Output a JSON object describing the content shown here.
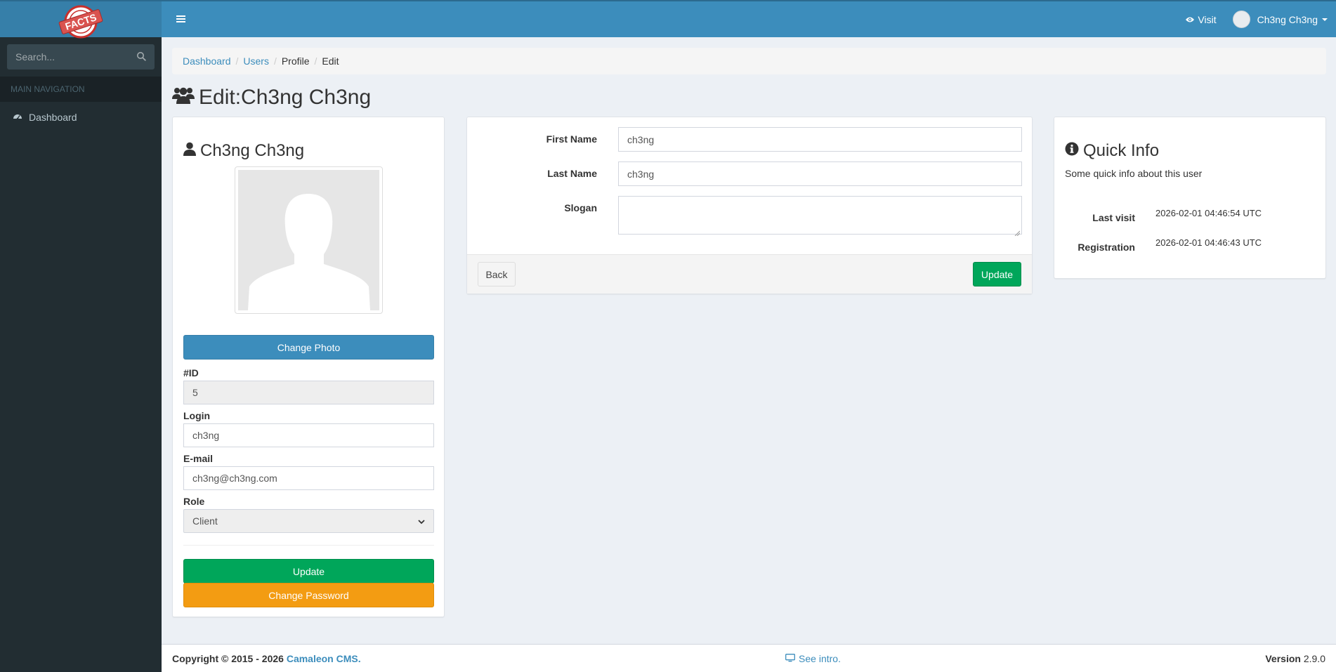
{
  "sidebar": {
    "logo_text": "FACTS",
    "search_placeholder": "Search...",
    "nav_header": "MAIN NAVIGATION",
    "items": [
      {
        "label": "Dashboard",
        "icon": "dashboard-icon"
      }
    ]
  },
  "topbar": {
    "visit_label": "Visit",
    "user_name": "Ch3ng Ch3ng"
  },
  "breadcrumb": {
    "items": [
      "Dashboard",
      "Users",
      "Profile",
      "Edit"
    ]
  },
  "page": {
    "title": "Edit:Ch3ng Ch3ng"
  },
  "profile": {
    "name": "Ch3ng Ch3ng",
    "change_photo_label": "Change Photo",
    "id_label": "#ID",
    "id_value": "5",
    "login_label": "Login",
    "login_value": "ch3ng",
    "email_label": "E-mail",
    "email_value": "ch3ng@ch3ng.com",
    "role_label": "Role",
    "role_value": "Client",
    "update_label": "Update",
    "change_password_label": "Change Password"
  },
  "form": {
    "first_name_label": "First Name",
    "first_name_value": "ch3ng",
    "last_name_label": "Last Name",
    "last_name_value": "ch3ng",
    "slogan_label": "Slogan",
    "slogan_value": "",
    "back_label": "Back",
    "update_label": "Update"
  },
  "quick_info": {
    "title": "Quick Info",
    "subtitle": "Some quick info about this user",
    "last_visit_label": "Last visit",
    "last_visit_value": "2026-02-01 04:46:54 UTC",
    "registration_label": "Registration",
    "registration_value": "2026-02-01 04:46:43 UTC"
  },
  "footer": {
    "copyright": "Copyright © 2015 - 2026",
    "cms_link": "Camaleon CMS.",
    "intro_label": "See intro.",
    "version_label": "Version",
    "version_value": "2.9.0"
  },
  "colors": {
    "topbar": "#3c8dbc",
    "sidebar": "#222d32",
    "primary": "#3c8dbc",
    "success": "#00a65a",
    "warning": "#f39c12"
  }
}
